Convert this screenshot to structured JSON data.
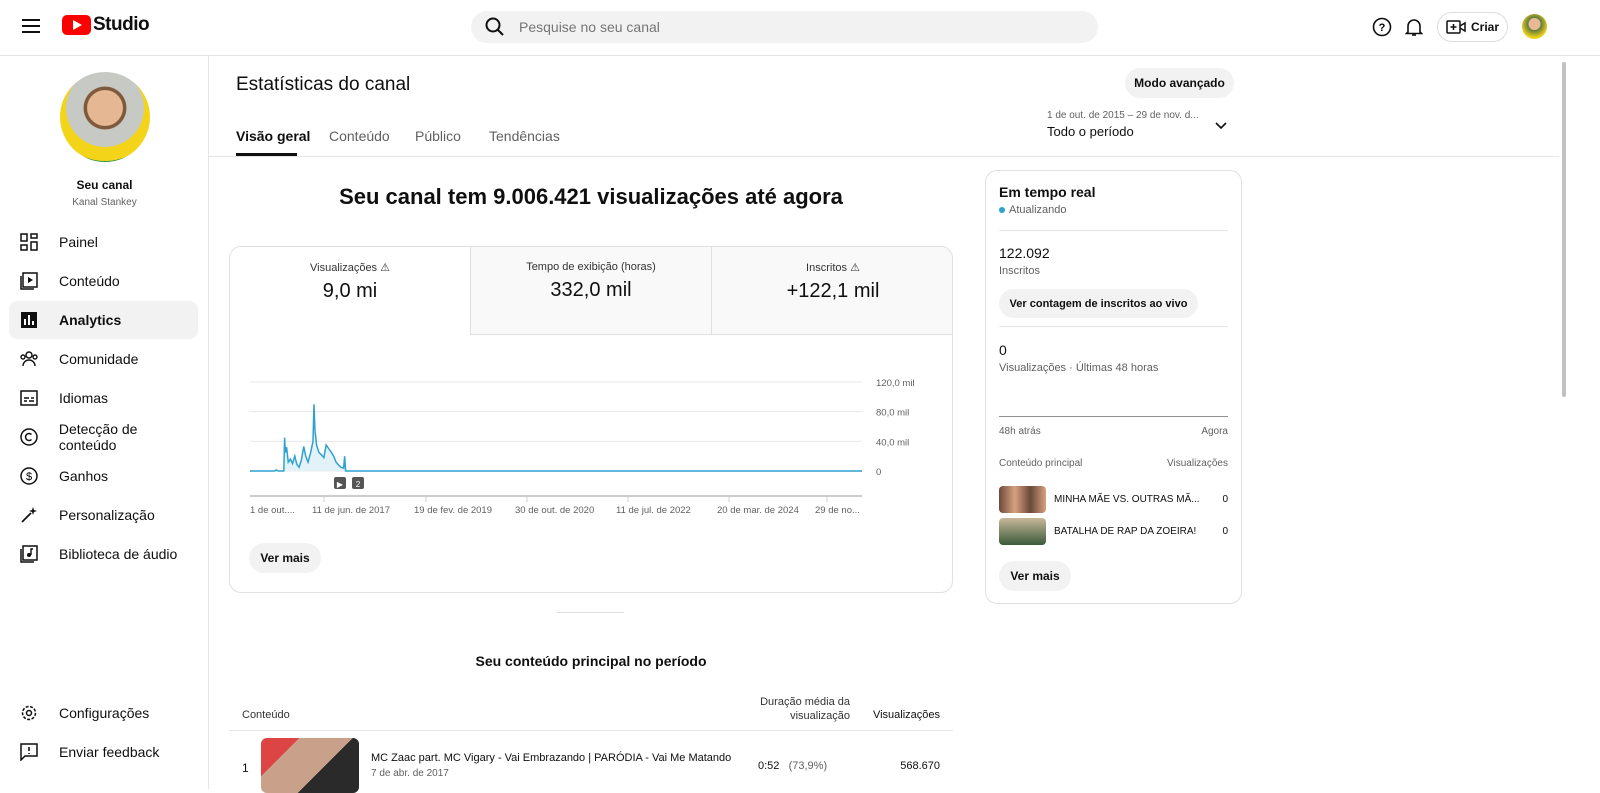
{
  "header": {
    "logo_text": "Studio",
    "search_placeholder": "Pesquise no seu canal",
    "create_label": "Criar"
  },
  "sidebar": {
    "channel_label": "Seu canal",
    "channel_name": "Kanal Stankey",
    "items": [
      {
        "label": "Painel",
        "icon": "dashboard-icon"
      },
      {
        "label": "Conteúdo",
        "icon": "content-icon"
      },
      {
        "label": "Analytics",
        "icon": "analytics-icon"
      },
      {
        "label": "Comunidade",
        "icon": "community-icon"
      },
      {
        "label": "Idiomas",
        "icon": "subtitles-icon"
      },
      {
        "label": "Detecção de conteúdo",
        "icon": "copyright-icon"
      },
      {
        "label": "Ganhos",
        "icon": "dollar-icon"
      },
      {
        "label": "Personalização",
        "icon": "magic-wand-icon"
      },
      {
        "label": "Biblioteca de áudio",
        "icon": "audio-library-icon"
      }
    ],
    "bottom": [
      {
        "label": "Configurações"
      },
      {
        "label": "Enviar feedback"
      }
    ]
  },
  "page": {
    "title": "Estatísticas do canal",
    "advanced_label": "Modo avançado",
    "date_range": "1 de out. de 2015 – 29 de nov. d...",
    "period": "Todo o período",
    "tabs": [
      "Visão geral",
      "Conteúdo",
      "Público",
      "Tendências"
    ],
    "headline": "Seu canal tem 9.006.421 visualizações até agora",
    "metrics": [
      {
        "label": "Visualizações",
        "value": "9,0 mi",
        "warn": true
      },
      {
        "label": "Tempo de exibição (horas)",
        "value": "332,0 mil",
        "warn": false
      },
      {
        "label": "Inscritos",
        "value": "+122,1 mil",
        "warn": true
      }
    ],
    "see_more": "Ver mais",
    "top_content_title": "Seu conteúdo principal no período",
    "table": {
      "headers": [
        "Conteúdo",
        "Duração média da visualização",
        "Visualizações"
      ],
      "rows": [
        {
          "rank": "1",
          "title": "MC Zaac part. MC Vigary - Vai Embrazando | PARÓDIA - Vai Me Matando",
          "date": "7 de abr. de 2017",
          "duration": "0:52",
          "pct": "(73,9%)",
          "views": "568.670"
        }
      ]
    }
  },
  "chart_data": {
    "type": "area",
    "ylim": [
      0,
      120
    ],
    "yticks": [
      "120,0 mil",
      "80,0 mil",
      "40,0 mil",
      "0"
    ],
    "ytick_values": [
      120,
      80,
      40,
      0
    ],
    "xlabels": [
      "1 de out....",
      "11 de jun. de 2017",
      "19 de fev. de 2019",
      "30 de out. de 2020",
      "11 de jul. de 2022",
      "20 de mar. de 2024",
      "29 de no..."
    ],
    "x_domain_days": [
      0,
      3712
    ],
    "points": [
      [
        0,
        0
      ],
      [
        150,
        0
      ],
      [
        160,
        1.5
      ],
      [
        170,
        0
      ],
      [
        205,
        0
      ],
      [
        210,
        45
      ],
      [
        214,
        25
      ],
      [
        222,
        32
      ],
      [
        232,
        12
      ],
      [
        245,
        16
      ],
      [
        258,
        10
      ],
      [
        272,
        20
      ],
      [
        284,
        9
      ],
      [
        298,
        5
      ],
      [
        312,
        15
      ],
      [
        326,
        33
      ],
      [
        338,
        20
      ],
      [
        352,
        12
      ],
      [
        368,
        25
      ],
      [
        382,
        40
      ],
      [
        388,
        90
      ],
      [
        394,
        55
      ],
      [
        404,
        35
      ],
      [
        418,
        25
      ],
      [
        432,
        22
      ],
      [
        448,
        18
      ],
      [
        462,
        35
      ],
      [
        478,
        30
      ],
      [
        494,
        25
      ],
      [
        508,
        20
      ],
      [
        522,
        12
      ],
      [
        538,
        8
      ],
      [
        552,
        5
      ],
      [
        568,
        4
      ],
      [
        574,
        20
      ],
      [
        580,
        0
      ],
      [
        3712,
        0
      ]
    ],
    "markers": [
      "▶",
      "2"
    ],
    "color": "#2ea1cf"
  },
  "realtime": {
    "title": "Em tempo real",
    "status": "Atualizando",
    "subs_value": "122.092",
    "subs_label": "Inscritos",
    "live_button": "Ver contagem de inscritos ao vivo",
    "views_value": "0",
    "views_label": "Visualizações · Últimas 48 horas",
    "axis_left": "48h atrás",
    "axis_right": "Agora",
    "col_content": "Conteúdo principal",
    "col_views": "Visualizações",
    "items": [
      {
        "title": "MINHA MÃE VS. OUTRAS MÃ...",
        "views": "0"
      },
      {
        "title": "BATALHA DE RAP DA ZOEIRA!",
        "views": "0"
      }
    ],
    "see_more": "Ver mais"
  }
}
